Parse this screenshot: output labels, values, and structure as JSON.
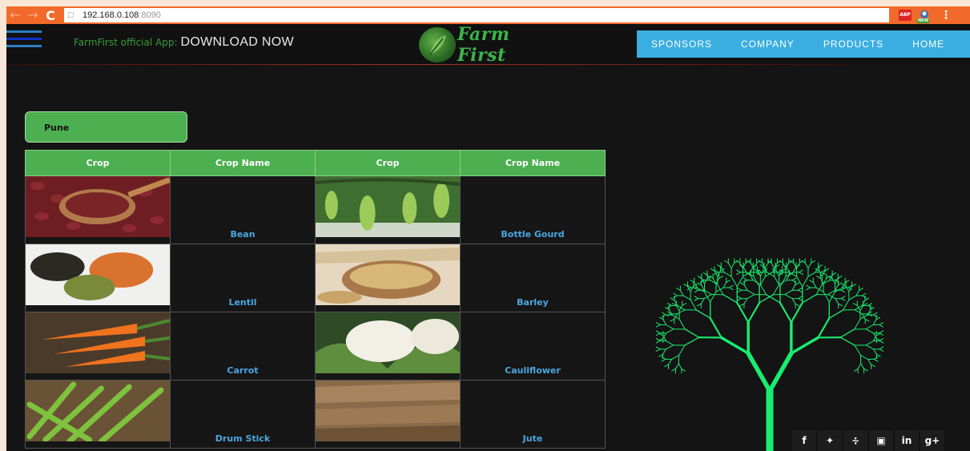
{
  "browser": {
    "back_icon": "back-arrow-icon",
    "forward_icon": "forward-arrow-icon",
    "reload_icon": "reload-icon",
    "url_host": "192.168.0.108",
    "url_port": ":8090",
    "ext_abp": "ABP",
    "ext_new_badge": "NEW"
  },
  "header": {
    "promo_label": "FarmFirst official App:",
    "promo_cta": "DOWNLOAD NOW",
    "logo_text": "Farm First",
    "nav": [
      "SPONSORS",
      "COMPANY",
      "PRODUCTS",
      "HOME"
    ]
  },
  "city": "Pune",
  "table": {
    "headers": [
      "Crop",
      "Crop Name",
      "Crop",
      "Crop Name"
    ],
    "rows": [
      {
        "left": "Bean",
        "right": "Bottle Gourd"
      },
      {
        "left": "Lentil",
        "right": "Barley"
      },
      {
        "left": "Carrot",
        "right": "Cauliflower"
      },
      {
        "left": "Drum Stick",
        "right": "Jute"
      }
    ]
  },
  "social": [
    "f",
    "t",
    "rss",
    "yt",
    "in",
    "g+"
  ],
  "colors": {
    "brand_green": "#4caf50",
    "nav_blue": "#3aaee0",
    "crop_name_blue": "#4aa6e0",
    "tree_green": "#19ec70",
    "browser_orange": "#f26a2a"
  }
}
